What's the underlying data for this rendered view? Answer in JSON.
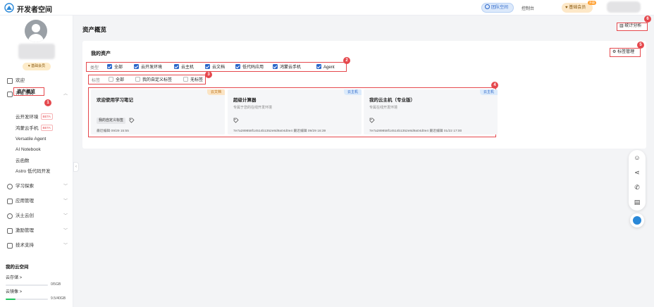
{
  "topbar": {
    "brand": "开发者空间",
    "team_space": "团队空间",
    "console": "控制台",
    "member": "基础会员",
    "member_badge": "升级"
  },
  "sidebar": {
    "member_level": "基础会员",
    "welcome": "欢迎",
    "dev_platform": "开发平台",
    "sub_items": [
      {
        "label": "资产概览"
      },
      {
        "label": "云开发环境",
        "badge": "BETA"
      },
      {
        "label": "鸿蒙云手机",
        "badge": "BETA"
      },
      {
        "label": "Versatile Agent"
      },
      {
        "label": "AI Notebook"
      },
      {
        "label": "云函数"
      },
      {
        "label": "Astro 低代码开发"
      }
    ],
    "groups": [
      "学习探索",
      "应用管理",
      "沃土云创",
      "激励管理",
      "技术支持"
    ],
    "cloud_space_title": "我的云空间",
    "cloud_storage": {
      "label": "云存储 >",
      "value": "0/5GB",
      "fraction": 0.0
    },
    "cloud_mirror": {
      "label": "云镜像 >",
      "value": "9.5/40GB",
      "fraction": 0.24
    }
  },
  "main": {
    "page_title": "资产概览",
    "stats_button": "统计分析",
    "assets_title": "我的资产",
    "tag_manage_button": "标签管理",
    "type_filter": {
      "label": "类型",
      "options": [
        "全部",
        "云开发环境",
        "云主机",
        "云文档",
        "低代码应用",
        "鸿蒙云手机",
        "Agent"
      ]
    },
    "tag_filter": {
      "label": "标签",
      "options": [
        "全部",
        "我的自定义标签",
        "无标签"
      ]
    },
    "cards": [
      {
        "ribbon": "云文档",
        "title": "欢迎使用学习笔记",
        "desc": "",
        "tag": "我的自定义标签",
        "footer": "最近编辑 09/29 15:55"
      },
      {
        "ribbon": "云主机",
        "title": "超级计算器",
        "desc": "专属于您的在线开发环境",
        "tag": "",
        "footer": "7e7a289858f14514b1352e8d9a04d0e4 最近编辑 09/29 16:39"
      },
      {
        "ribbon": "云主机",
        "title": "我的云主机（专业版）",
        "desc": "专属在线开发环境",
        "tag": "",
        "footer": "7e7a289858f14514b1352e8d9a04d0e4 最近编辑 01/22 17:00"
      }
    ]
  },
  "callouts": [
    "1",
    "2",
    "3",
    "4",
    "5",
    "6"
  ],
  "colors": {
    "accent": "#2a66c9",
    "highlight": "#e5484d",
    "doc_ribbon": "#fbe4c4",
    "host_ribbon": "#dbeafb"
  }
}
